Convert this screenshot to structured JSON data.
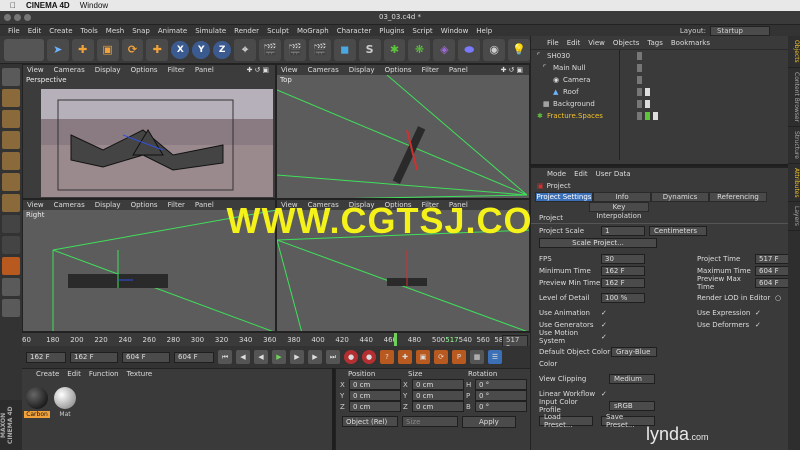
{
  "mac_menu": {
    "app": "CINEMA 4D",
    "window": "Window"
  },
  "window_title": "03_03.c4d *",
  "app_menu": [
    "File",
    "Edit",
    "Create",
    "Tools",
    "Mesh",
    "Snap",
    "Animate",
    "Simulate",
    "Render",
    "Sculpt",
    "MoGraph",
    "Character",
    "Plugins",
    "Script",
    "Window",
    "Help"
  ],
  "layout": {
    "label": "Layout:",
    "value": "Startup"
  },
  "toolbar": {
    "x_label": "X",
    "y_label": "Y",
    "z_label": "Z"
  },
  "viewports": [
    {
      "label": "Perspective",
      "menu": [
        "View",
        "Cameras",
        "Display",
        "Options",
        "Filter",
        "Panel"
      ]
    },
    {
      "label": "Top",
      "menu": [
        "View",
        "Cameras",
        "Display",
        "Options",
        "Filter",
        "Panel"
      ]
    },
    {
      "label": "Right",
      "menu": [
        "View",
        "Cameras",
        "Display",
        "Options",
        "Filter",
        "Panel"
      ]
    },
    {
      "label": "",
      "menu": [
        "View",
        "Cameras",
        "Display",
        "Options",
        "Filter",
        "Panel"
      ]
    }
  ],
  "watermark": "WWW.CGTSJ.COM",
  "timeline": {
    "ticks": [
      "60",
      "180",
      "200",
      "220",
      "240",
      "260",
      "280",
      "300",
      "320",
      "340",
      "360",
      "380",
      "400",
      "420",
      "440",
      "460",
      "480",
      "500"
    ],
    "after_cursor": [
      "540",
      "560",
      "580",
      "600"
    ],
    "current": "517",
    "end_field": "517 F"
  },
  "transport": {
    "start": "162 F",
    "range_start": "162 F",
    "range_end": "604 F",
    "end": "604 F"
  },
  "material_manager": {
    "menu": [
      "Create",
      "Edit",
      "Function",
      "Texture"
    ],
    "materials": [
      {
        "name": "Carbon",
        "color": "#111111"
      },
      {
        "name": "Mat",
        "color": "#bdbdbd"
      }
    ]
  },
  "coords": {
    "headers": [
      "Position",
      "Size",
      "Rotation"
    ],
    "rows": [
      {
        "ax1": "X",
        "v1": "0 cm",
        "ax2": "X",
        "v2": "0 cm",
        "ax3": "H",
        "v3": "0 °"
      },
      {
        "ax1": "Y",
        "v1": "0 cm",
        "ax2": "Y",
        "v2": "0 cm",
        "ax3": "P",
        "v3": "0 °"
      },
      {
        "ax1": "Z",
        "v1": "0 cm",
        "ax2": "Z",
        "v2": "0 cm",
        "ax3": "B",
        "v3": "0 °"
      }
    ],
    "mode": "Object (Rel)",
    "size_mode": "Size",
    "apply": "Apply"
  },
  "maxon": "MAXON CINEMA 4D",
  "object_manager": {
    "menu": [
      "File",
      "Edit",
      "View",
      "Objects",
      "Tags",
      "Bookmarks"
    ],
    "objects": [
      {
        "name": "SH030",
        "selected": false
      },
      {
        "name": "Main Null",
        "selected": false
      },
      {
        "name": "Camera",
        "selected": false
      },
      {
        "name": "Roof",
        "selected": false
      },
      {
        "name": "Background",
        "selected": false
      },
      {
        "name": "Fracture.Spaces",
        "selected": true
      }
    ]
  },
  "attributes": {
    "menu": [
      "Mode",
      "Edit",
      "User Data"
    ],
    "title": "Project",
    "tabs": [
      "Project Settings",
      "Info",
      "Dynamics",
      "Referencing"
    ],
    "tab2": "Key Interpolation",
    "section": "Project",
    "project_scale": {
      "label": "Project Scale",
      "value": "1",
      "unit": "Centimeters"
    },
    "scale_project_btn": "Scale Project...",
    "fps": {
      "label": "FPS",
      "value": "30"
    },
    "project_time": {
      "label": "Project Time",
      "value": "517 F"
    },
    "min_time": {
      "label": "Minimum Time",
      "value": "162 F"
    },
    "max_time": {
      "label": "Maximum Time",
      "value": "604 F"
    },
    "prev_min": {
      "label": "Preview Min Time",
      "value": "162 F"
    },
    "prev_max": {
      "label": "Preview Max Time",
      "value": "604 F"
    },
    "lod": {
      "label": "Level of Detail",
      "value": "100 %"
    },
    "render_lod": "Render LOD in Editor",
    "use_animation": "Use Animation",
    "use_expression": "Use Expression",
    "use_generators": "Use Generators",
    "use_deformers": "Use Deformers",
    "use_motion": "Use Motion System",
    "default_color": {
      "label": "Default Object Color",
      "value": "Gray-Blue"
    },
    "color_label": "Color",
    "view_clipping": {
      "label": "View Clipping",
      "value": "Medium"
    },
    "linear_workflow": "Linear Workflow",
    "input_profile": {
      "label": "Input Color Profile",
      "value": "sRGB"
    },
    "load_preset": "Load Preset...",
    "save_preset": "Save Preset..."
  },
  "right_tabs": [
    "Objects",
    "Content Browser",
    "Structure",
    "Attributes",
    "Layers"
  ],
  "lynda": {
    "brand": "lynda",
    "suffix": ".com"
  }
}
